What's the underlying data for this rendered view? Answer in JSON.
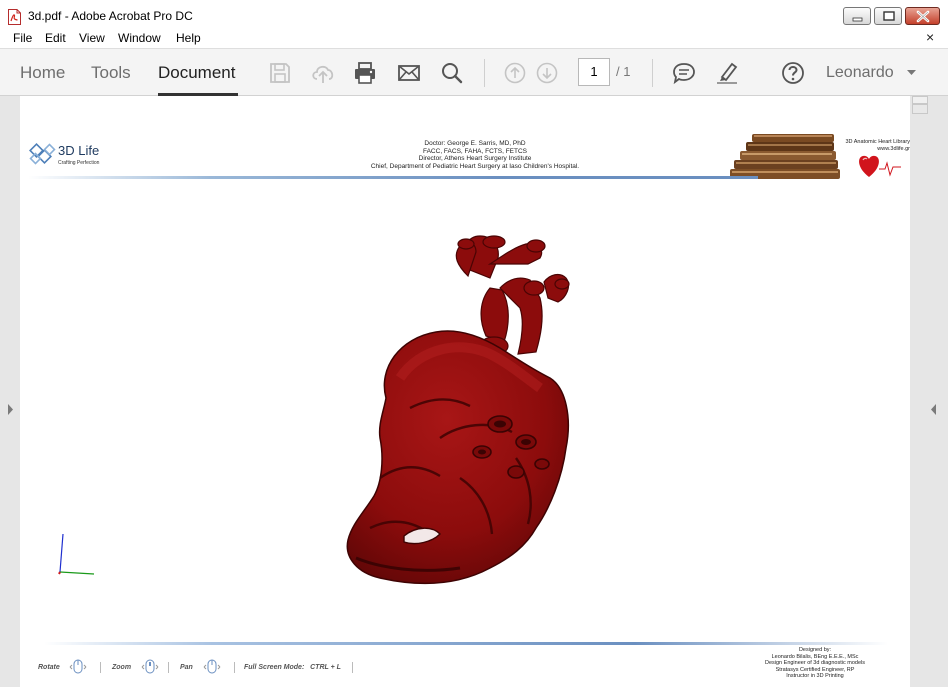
{
  "window": {
    "title": "3d.pdf - Adobe Acrobat Pro DC",
    "close_glyph": "×"
  },
  "menu": {
    "items": [
      "File",
      "Edit",
      "View",
      "Window",
      "Help"
    ]
  },
  "toolbar": {
    "tabs": [
      "Home",
      "Tools",
      "Document"
    ],
    "active_tab": "Document",
    "page_current": "1",
    "page_total": "/ 1",
    "user": "Leonardo",
    "icons": [
      "save-icon",
      "cloud-upload-icon",
      "print-icon",
      "email-icon",
      "search-icon",
      "page-up-icon",
      "page-down-icon",
      "comment-icon",
      "highlight-pen-icon",
      "help-icon"
    ]
  },
  "document": {
    "logo": {
      "name": "3D Life",
      "tagline": "Crafting Perfection"
    },
    "header_lines": [
      "Doctor: George E. Sarris, MD, PhD",
      "FACC, FACS, FAHA, FCTS, FETCS",
      "Director, Athens Heart Surgery Institute",
      "Chief, Department of Pediatric Heart Surgery at Iaso Children's Hospital."
    ],
    "library": {
      "title": "3D Anatomic Heart Library",
      "url": "www.3dlife.gr"
    },
    "controls": {
      "rotate": "Rotate",
      "zoom": "Zoom",
      "pan": "Pan",
      "fullscreen": "Full Screen Mode:   CTRL + L"
    },
    "credits": [
      "Designed by:",
      "Leonardo Bilalis, BEng E.E.E., MSc",
      "Design Engineer of 3d diagnostic models",
      "Stratasys Certified Engineer, RP",
      "Instructor in 3D Printing"
    ]
  },
  "colors": {
    "heart": "#8c0c0c",
    "heart_dark": "#4a0404",
    "accent_line": "#6a8fc0"
  }
}
